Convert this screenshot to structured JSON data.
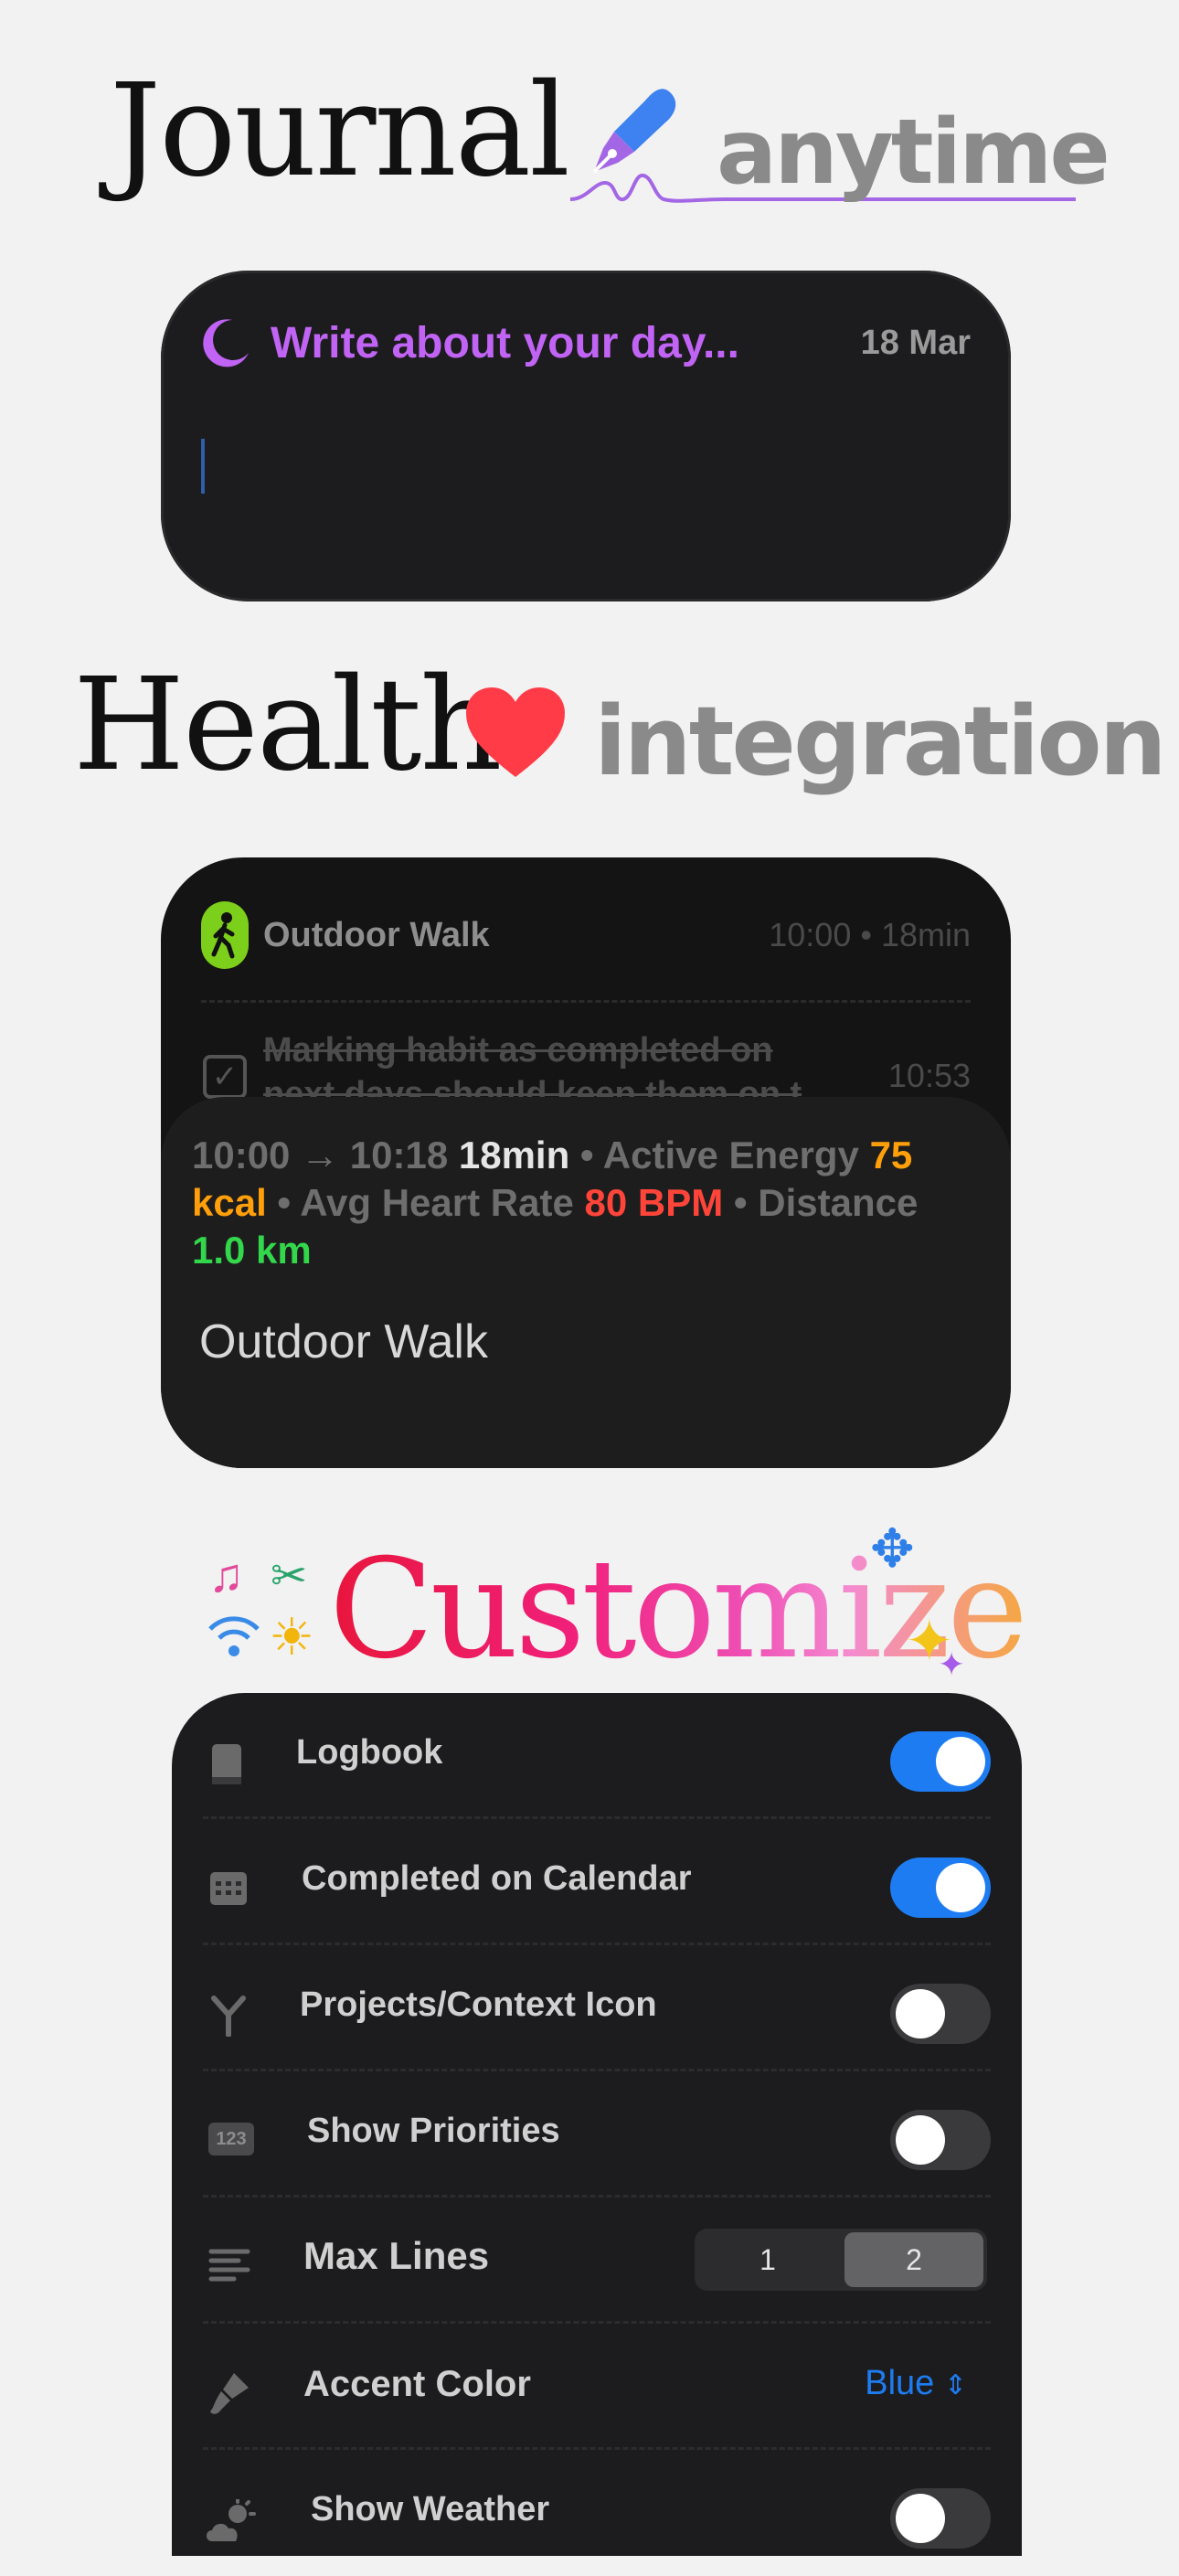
{
  "journal": {
    "heading_serif": "Journal",
    "heading_word": "anytime",
    "prompt": "Write about your day...",
    "date": "18 Mar"
  },
  "health": {
    "heading_serif": "Health",
    "heading_word": "integration",
    "workout_title": "Outdoor Walk",
    "workout_time": "10:00 • 18min",
    "task_text_1": "Marking habit as completed on",
    "task_text_2": "next days should keep them on t",
    "task_time": "10:53",
    "metrics": {
      "range": "10:00 → 10:18",
      "duration": "18min",
      "bullet": "•",
      "energy_label": "Active Energy",
      "energy_value": "75",
      "energy_unit": "kcal",
      "hr_label": "Avg Heart Rate",
      "hr_value": "80 BPM",
      "distance_label": "Distance",
      "distance_value": "1.0 km"
    },
    "detail_title": "Outdoor Walk"
  },
  "customize": {
    "heading": "Customize"
  },
  "settings": {
    "rows": [
      {
        "label": "Logbook",
        "icon": "book-icon",
        "control": "toggle",
        "on": true
      },
      {
        "label": "Completed on Calendar",
        "icon": "calendar-icon",
        "control": "toggle",
        "on": true
      },
      {
        "label": "Projects/Context Icon",
        "icon": "fork-icon",
        "control": "toggle",
        "on": false
      },
      {
        "label": "Show Priorities",
        "icon": "numbers-icon",
        "control": "toggle",
        "on": false
      },
      {
        "label": "Max Lines",
        "icon": "lines-icon",
        "control": "segmented",
        "options": [
          "1",
          "2"
        ],
        "selected": "2"
      },
      {
        "label": "Accent Color",
        "icon": "paintbrush-icon",
        "control": "select",
        "value": "Blue"
      },
      {
        "label": "Show Weather",
        "icon": "weather-icon",
        "control": "toggle",
        "on": false
      }
    ],
    "numbers_icon_text": "123"
  },
  "colors": {
    "accent": "#1e7cf2",
    "journal_purple": "#c164f5",
    "heart": "#ff3b47",
    "walk_green": "#7ccf1a"
  }
}
